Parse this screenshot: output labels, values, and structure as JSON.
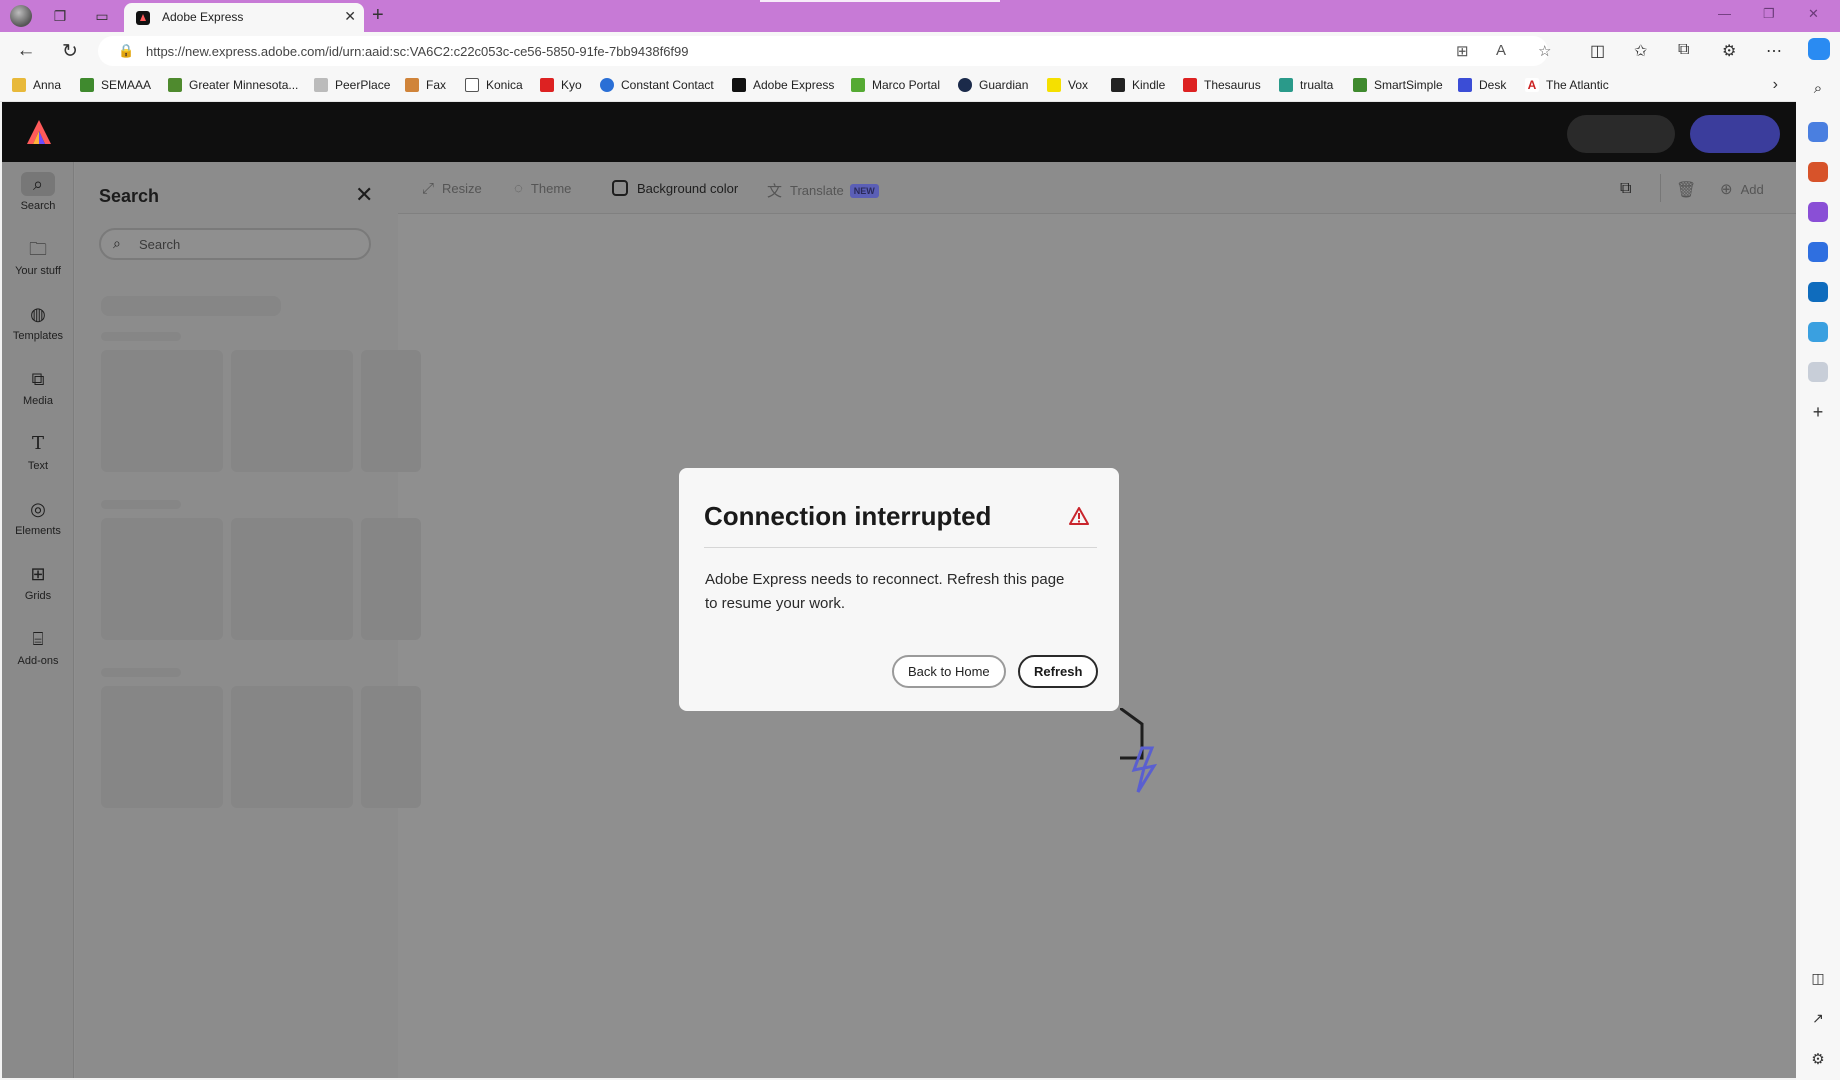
{
  "browser": {
    "tab_title": "Adobe Express",
    "url": "https://new.express.adobe.com/id/urn:aaid:sc:VA6C2:c22c053c-ce56-5850-91fe-7bb9438f6f99",
    "bookmarks": [
      "Anna",
      "SEMAAA",
      "Greater Minnesota...",
      "PeerPlace",
      "Fax",
      "Konica",
      "Kyo",
      "Constant Contact",
      "Adobe Express",
      "Marco Portal",
      "Guardian",
      "Vox",
      "Kindle",
      "Thesaurus",
      "trualta",
      "SmartSimple",
      "Desk",
      "The Atlantic"
    ]
  },
  "rail": [
    {
      "label": "Search",
      "icon": "search-icon"
    },
    {
      "label": "Your stuff",
      "icon": "folder-icon"
    },
    {
      "label": "Templates",
      "icon": "templates-icon"
    },
    {
      "label": "Media",
      "icon": "media-icon"
    },
    {
      "label": "Text",
      "icon": "text-icon"
    },
    {
      "label": "Elements",
      "icon": "shapes-icon"
    },
    {
      "label": "Grids",
      "icon": "grid-icon"
    },
    {
      "label": "Add-ons",
      "icon": "addons-icon"
    }
  ],
  "panel": {
    "title": "Search",
    "search_placeholder": "Search"
  },
  "toolbar": {
    "resize": "Resize",
    "theme": "Theme",
    "background_color": "Background color",
    "translate": "Translate",
    "translate_badge": "NEW",
    "add": "Add"
  },
  "dialog": {
    "title": "Connection interrupted",
    "message": "Adobe Express needs to reconnect. Refresh this page to resume your work.",
    "back_button": "Back to Home",
    "refresh_button": "Refresh"
  },
  "colors": {
    "titlebar": "#c77ad6",
    "accent_blue": "#3b3d9c",
    "warning_red": "#c9252d"
  }
}
